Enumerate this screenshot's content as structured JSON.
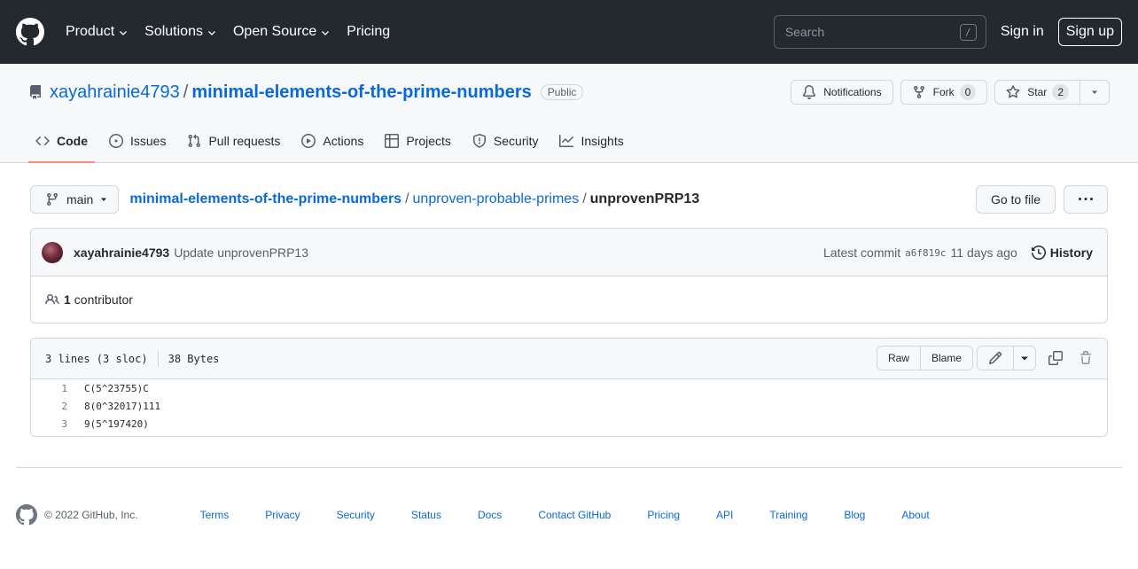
{
  "header": {
    "nav": [
      {
        "label": "Product",
        "dropdown": true
      },
      {
        "label": "Solutions",
        "dropdown": true
      },
      {
        "label": "Open Source",
        "dropdown": true
      },
      {
        "label": "Pricing",
        "dropdown": false
      }
    ],
    "search_placeholder": "Search",
    "search_shortcut": "/",
    "signin_label": "Sign in",
    "signup_label": "Sign up"
  },
  "repo": {
    "owner": "xayahrainie4793",
    "name": "minimal-elements-of-the-prime-numbers",
    "visibility": "Public",
    "notifications_label": "Notifications",
    "fork_label": "Fork",
    "fork_count": "0",
    "star_label": "Star",
    "star_count": "2"
  },
  "tabs": [
    {
      "label": "Code",
      "icon": "code-icon",
      "selected": true
    },
    {
      "label": "Issues",
      "icon": "issue-opened-icon",
      "selected": false
    },
    {
      "label": "Pull requests",
      "icon": "git-pull-request-icon",
      "selected": false
    },
    {
      "label": "Actions",
      "icon": "play-icon",
      "selected": false
    },
    {
      "label": "Projects",
      "icon": "table-icon",
      "selected": false
    },
    {
      "label": "Security",
      "icon": "shield-icon",
      "selected": false
    },
    {
      "label": "Insights",
      "icon": "graph-icon",
      "selected": false
    }
  ],
  "file_nav": {
    "branch": "main",
    "breadcrumb_root": "minimal-elements-of-the-prime-numbers",
    "breadcrumb_dir": "unproven-probable-primes",
    "separator": "/",
    "file_name": "unprovenPRP13",
    "go_to_file_label": "Go to file"
  },
  "commit": {
    "author": "xayahrainie4793",
    "message": "Update unprovenPRP13",
    "latest_label": "Latest commit",
    "sha": "a6f819c",
    "time": "11 days ago",
    "history_label": "History",
    "contributors_count": "1",
    "contributors_label": "contributor"
  },
  "file": {
    "lines_info": "3 lines (3 sloc)",
    "size": "38 Bytes",
    "raw_label": "Raw",
    "blame_label": "Blame",
    "lines": [
      {
        "num": "1",
        "text": "C(5^23755)C"
      },
      {
        "num": "2",
        "text": "8(0^32017)111"
      },
      {
        "num": "3",
        "text": "9(5^197420)"
      }
    ]
  },
  "footer": {
    "copyright": "© 2022 GitHub, Inc.",
    "links": [
      "Terms",
      "Privacy",
      "Security",
      "Status",
      "Docs",
      "Contact GitHub",
      "Pricing",
      "API",
      "Training",
      "Blog",
      "About"
    ]
  },
  "colors": {
    "header_bg": "#24292f",
    "link_blue": "#0969da",
    "tab_underline": "#fd8c73",
    "border": "#d0d7de"
  }
}
